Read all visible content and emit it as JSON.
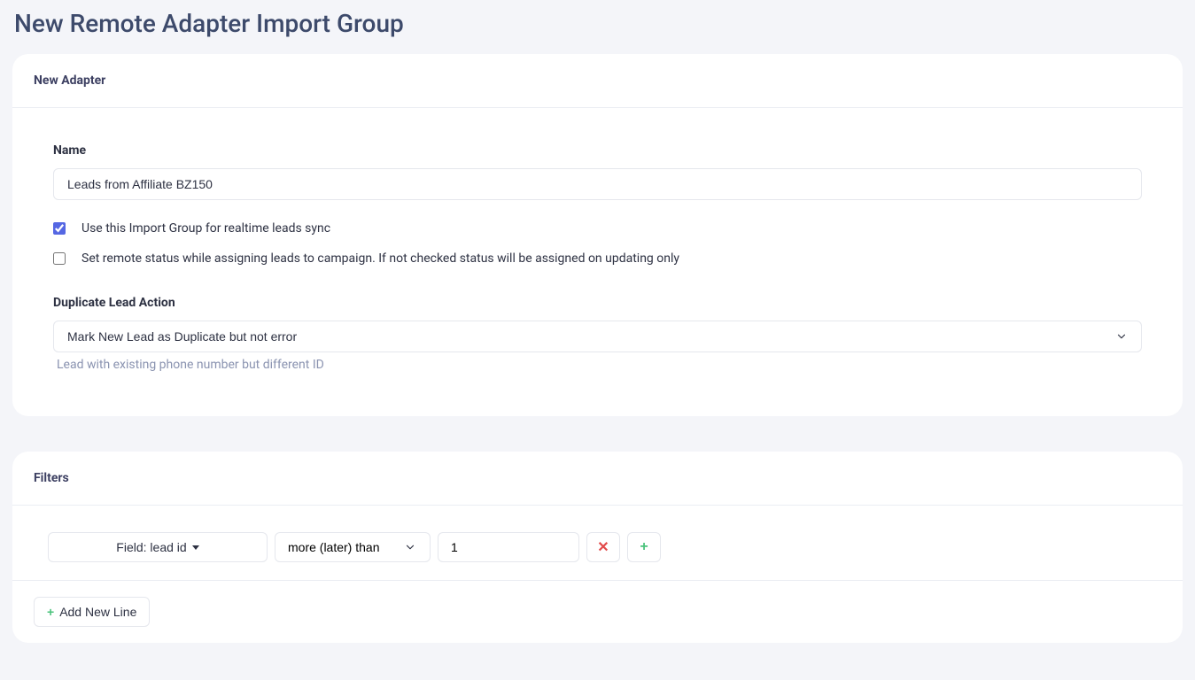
{
  "page": {
    "title": "New Remote Adapter Import Group"
  },
  "adapter_card": {
    "header": "New Adapter",
    "name_label": "Name",
    "name_value": "Leads from Affiliate BZ150",
    "checkbox_realtime": {
      "checked": true,
      "label": "Use this Import Group for realtime leads sync"
    },
    "checkbox_remote_status": {
      "checked": false,
      "label": "Set remote status while assigning leads to campaign. If not checked status will be assigned on updating only"
    },
    "duplicate_action": {
      "label": "Duplicate Lead Action",
      "selected": "Mark New Lead as Duplicate but not error",
      "help": "Lead with existing phone number but different ID"
    }
  },
  "filters_card": {
    "header": "Filters",
    "rows": [
      {
        "field_label": "Field: lead id",
        "operator": "more (later) than",
        "value": "1"
      }
    ],
    "add_new_line": "Add New Line"
  }
}
